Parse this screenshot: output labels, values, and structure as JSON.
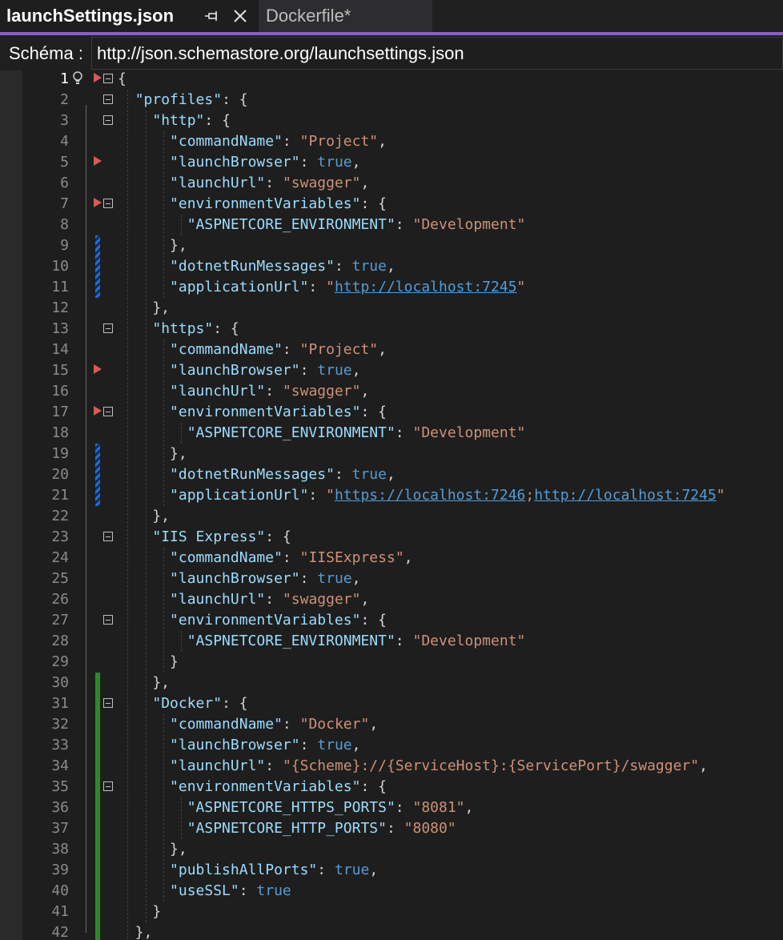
{
  "tabs": [
    {
      "label": "launchSettings.json"
    },
    {
      "label": "Dockerfile*"
    }
  ],
  "schema": {
    "label": "Schéma :",
    "value": "http://json.schemastore.org/launchsettings.json"
  },
  "colors": {
    "accent": "#8661c5",
    "key": "#9cdcfe",
    "string": "#ce9178",
    "bool": "#569cd6",
    "breakpoint": "#d75a5a",
    "change_green": "#2a8a2a",
    "change_blue": "#1e6fd9"
  },
  "lines": [
    {
      "n": "1",
      "segs": [
        [
          "p",
          "{"
        ]
      ]
    },
    {
      "n": "2",
      "segs": [
        [
          "p",
          "  "
        ],
        [
          "k",
          "\"profiles\""
        ],
        [
          "p",
          ": {"
        ]
      ]
    },
    {
      "n": "3",
      "segs": [
        [
          "p",
          "    "
        ],
        [
          "k",
          "\"http\""
        ],
        [
          "p",
          ": {"
        ]
      ]
    },
    {
      "n": "4",
      "segs": [
        [
          "p",
          "      "
        ],
        [
          "k",
          "\"commandName\""
        ],
        [
          "p",
          ": "
        ],
        [
          "s",
          "\"Project\""
        ],
        [
          "p",
          ","
        ]
      ]
    },
    {
      "n": "5",
      "segs": [
        [
          "p",
          "      "
        ],
        [
          "k",
          "\"launchBrowser\""
        ],
        [
          "p",
          ": "
        ],
        [
          "b",
          "true"
        ],
        [
          "p",
          ","
        ]
      ]
    },
    {
      "n": "6",
      "segs": [
        [
          "p",
          "      "
        ],
        [
          "k",
          "\"launchUrl\""
        ],
        [
          "p",
          ": "
        ],
        [
          "s",
          "\"swagger\""
        ],
        [
          "p",
          ","
        ]
      ]
    },
    {
      "n": "7",
      "segs": [
        [
          "p",
          "      "
        ],
        [
          "k",
          "\"environmentVariables\""
        ],
        [
          "p",
          ": {"
        ]
      ]
    },
    {
      "n": "8",
      "segs": [
        [
          "p",
          "        "
        ],
        [
          "k",
          "\"ASPNETCORE_ENVIRONMENT\""
        ],
        [
          "p",
          ": "
        ],
        [
          "s",
          "\"Development\""
        ]
      ]
    },
    {
      "n": "9",
      "segs": [
        [
          "p",
          "      },"
        ]
      ]
    },
    {
      "n": "10",
      "segs": [
        [
          "p",
          "      "
        ],
        [
          "k",
          "\"dotnetRunMessages\""
        ],
        [
          "p",
          ": "
        ],
        [
          "b",
          "true"
        ],
        [
          "p",
          ","
        ]
      ]
    },
    {
      "n": "11",
      "segs": [
        [
          "p",
          "      "
        ],
        [
          "k",
          "\"applicationUrl\""
        ],
        [
          "p",
          ": "
        ],
        [
          "s",
          "\""
        ],
        [
          "l",
          "http://localhost:7245"
        ],
        [
          "s",
          "\""
        ]
      ]
    },
    {
      "n": "12",
      "segs": [
        [
          "p",
          "    },"
        ]
      ]
    },
    {
      "n": "13",
      "segs": [
        [
          "p",
          "    "
        ],
        [
          "k",
          "\"https\""
        ],
        [
          "p",
          ": {"
        ]
      ]
    },
    {
      "n": "14",
      "segs": [
        [
          "p",
          "      "
        ],
        [
          "k",
          "\"commandName\""
        ],
        [
          "p",
          ": "
        ],
        [
          "s",
          "\"Project\""
        ],
        [
          "p",
          ","
        ]
      ]
    },
    {
      "n": "15",
      "segs": [
        [
          "p",
          "      "
        ],
        [
          "k",
          "\"launchBrowser\""
        ],
        [
          "p",
          ": "
        ],
        [
          "b",
          "true"
        ],
        [
          "p",
          ","
        ]
      ]
    },
    {
      "n": "16",
      "segs": [
        [
          "p",
          "      "
        ],
        [
          "k",
          "\"launchUrl\""
        ],
        [
          "p",
          ": "
        ],
        [
          "s",
          "\"swagger\""
        ],
        [
          "p",
          ","
        ]
      ]
    },
    {
      "n": "17",
      "segs": [
        [
          "p",
          "      "
        ],
        [
          "k",
          "\"environmentVariables\""
        ],
        [
          "p",
          ": {"
        ]
      ]
    },
    {
      "n": "18",
      "segs": [
        [
          "p",
          "        "
        ],
        [
          "k",
          "\"ASPNETCORE_ENVIRONMENT\""
        ],
        [
          "p",
          ": "
        ],
        [
          "s",
          "\"Development\""
        ]
      ]
    },
    {
      "n": "19",
      "segs": [
        [
          "p",
          "      },"
        ]
      ]
    },
    {
      "n": "20",
      "segs": [
        [
          "p",
          "      "
        ],
        [
          "k",
          "\"dotnetRunMessages\""
        ],
        [
          "p",
          ": "
        ],
        [
          "b",
          "true"
        ],
        [
          "p",
          ","
        ]
      ]
    },
    {
      "n": "21",
      "segs": [
        [
          "p",
          "      "
        ],
        [
          "k",
          "\"applicationUrl\""
        ],
        [
          "p",
          ": "
        ],
        [
          "s",
          "\""
        ],
        [
          "l",
          "https://localhost:7246"
        ],
        [
          "s",
          ";"
        ],
        [
          "l",
          "http://localhost:7245"
        ],
        [
          "s",
          "\""
        ]
      ]
    },
    {
      "n": "22",
      "segs": [
        [
          "p",
          "    },"
        ]
      ]
    },
    {
      "n": "23",
      "segs": [
        [
          "p",
          "    "
        ],
        [
          "k",
          "\"IIS Express\""
        ],
        [
          "p",
          ": {"
        ]
      ]
    },
    {
      "n": "24",
      "segs": [
        [
          "p",
          "      "
        ],
        [
          "k",
          "\"commandName\""
        ],
        [
          "p",
          ": "
        ],
        [
          "s",
          "\"IISExpress\""
        ],
        [
          "p",
          ","
        ]
      ]
    },
    {
      "n": "25",
      "segs": [
        [
          "p",
          "      "
        ],
        [
          "k",
          "\"launchBrowser\""
        ],
        [
          "p",
          ": "
        ],
        [
          "b",
          "true"
        ],
        [
          "p",
          ","
        ]
      ]
    },
    {
      "n": "26",
      "segs": [
        [
          "p",
          "      "
        ],
        [
          "k",
          "\"launchUrl\""
        ],
        [
          "p",
          ": "
        ],
        [
          "s",
          "\"swagger\""
        ],
        [
          "p",
          ","
        ]
      ]
    },
    {
      "n": "27",
      "segs": [
        [
          "p",
          "      "
        ],
        [
          "k",
          "\"environmentVariables\""
        ],
        [
          "p",
          ": {"
        ]
      ]
    },
    {
      "n": "28",
      "segs": [
        [
          "p",
          "        "
        ],
        [
          "k",
          "\"ASPNETCORE_ENVIRONMENT\""
        ],
        [
          "p",
          ": "
        ],
        [
          "s",
          "\"Development\""
        ]
      ]
    },
    {
      "n": "29",
      "segs": [
        [
          "p",
          "      }"
        ]
      ]
    },
    {
      "n": "30",
      "segs": [
        [
          "p",
          "    },"
        ]
      ]
    },
    {
      "n": "31",
      "segs": [
        [
          "p",
          "    "
        ],
        [
          "k",
          "\"Docker\""
        ],
        [
          "p",
          ": {"
        ]
      ]
    },
    {
      "n": "32",
      "segs": [
        [
          "p",
          "      "
        ],
        [
          "k",
          "\"commandName\""
        ],
        [
          "p",
          ": "
        ],
        [
          "s",
          "\"Docker\""
        ],
        [
          "p",
          ","
        ]
      ]
    },
    {
      "n": "33",
      "segs": [
        [
          "p",
          "      "
        ],
        [
          "k",
          "\"launchBrowser\""
        ],
        [
          "p",
          ": "
        ],
        [
          "b",
          "true"
        ],
        [
          "p",
          ","
        ]
      ]
    },
    {
      "n": "34",
      "segs": [
        [
          "p",
          "      "
        ],
        [
          "k",
          "\"launchUrl\""
        ],
        [
          "p",
          ": "
        ],
        [
          "s",
          "\"{Scheme}://{ServiceHost}:{ServicePort}/swagger\""
        ],
        [
          "p",
          ","
        ]
      ]
    },
    {
      "n": "35",
      "segs": [
        [
          "p",
          "      "
        ],
        [
          "k",
          "\"environmentVariables\""
        ],
        [
          "p",
          ": {"
        ]
      ]
    },
    {
      "n": "36",
      "segs": [
        [
          "p",
          "        "
        ],
        [
          "k",
          "\"ASPNETCORE_HTTPS_PORTS\""
        ],
        [
          "p",
          ": "
        ],
        [
          "s",
          "\"8081\""
        ],
        [
          "p",
          ","
        ]
      ]
    },
    {
      "n": "37",
      "segs": [
        [
          "p",
          "        "
        ],
        [
          "k",
          "\"ASPNETCORE_HTTP_PORTS\""
        ],
        [
          "p",
          ": "
        ],
        [
          "s",
          "\"8080\""
        ]
      ]
    },
    {
      "n": "38",
      "segs": [
        [
          "p",
          "      },"
        ]
      ]
    },
    {
      "n": "39",
      "segs": [
        [
          "p",
          "      "
        ],
        [
          "k",
          "\"publishAllPorts\""
        ],
        [
          "p",
          ": "
        ],
        [
          "b",
          "true"
        ],
        [
          "p",
          ","
        ]
      ]
    },
    {
      "n": "40",
      "segs": [
        [
          "p",
          "      "
        ],
        [
          "k",
          "\"useSSL\""
        ],
        [
          "p",
          ": "
        ],
        [
          "b",
          "true"
        ]
      ]
    },
    {
      "n": "41",
      "segs": [
        [
          "p",
          "    }"
        ]
      ]
    },
    {
      "n": "42",
      "segs": [
        [
          "p",
          "  },"
        ]
      ]
    }
  ]
}
